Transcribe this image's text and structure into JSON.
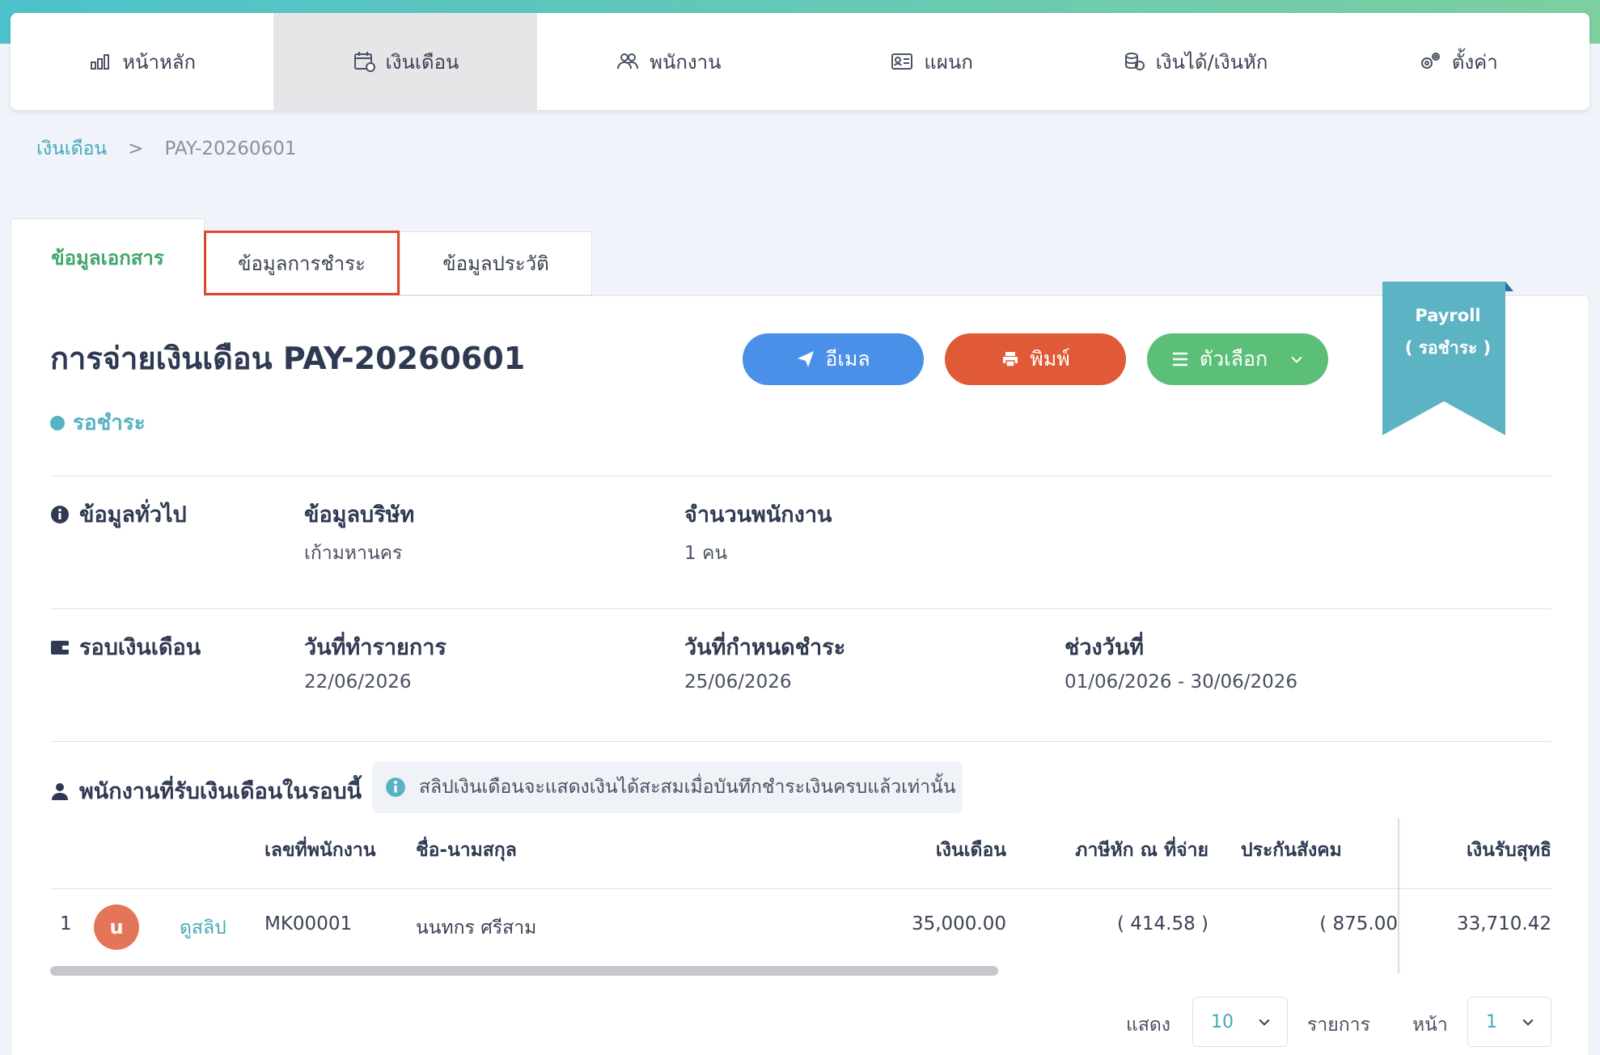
{
  "nav": {
    "items": [
      {
        "label": "หน้าหลัก",
        "icon": "chart-icon"
      },
      {
        "label": "เงินเดือน",
        "icon": "calendar-money-icon"
      },
      {
        "label": "พนักงาน",
        "icon": "users-icon"
      },
      {
        "label": "แผนก",
        "icon": "id-card-icon"
      },
      {
        "label": "เงินได้/เงินหัก",
        "icon": "coins-icon"
      },
      {
        "label": "ตั้งค่า",
        "icon": "gears-icon"
      }
    ]
  },
  "breadcrumb": {
    "parent": "เงินเดือน",
    "separator": ">",
    "current": "PAY-20260601"
  },
  "tabs": [
    {
      "label": "ข้อมูลเอกสาร"
    },
    {
      "label": "ข้อมูลการชำระ"
    },
    {
      "label": "ข้อมูลประวัติ"
    }
  ],
  "document": {
    "title": "การจ่ายเงินเดือน PAY-20260601",
    "status": "รอชำระ",
    "ribbon_line1": "Payroll",
    "ribbon_line2": "( รอชำระ )"
  },
  "actions": {
    "email": "อีเมล",
    "print": "พิมพ์",
    "options": "ตัวเลือก"
  },
  "general": {
    "section": "ข้อมูลทั่วไป",
    "company_title": "ข้อมูลบริษัท",
    "company_value": "เก้ามหานคร",
    "employees_title": "จำนวนพนักงาน",
    "employees_value": "1 คน"
  },
  "cycle": {
    "section": "รอบเงินเดือน",
    "txn_date_title": "วันที่ทำรายการ",
    "txn_date_value": "22/06/2026",
    "due_date_title": "วันที่กำหนดชำระ",
    "due_date_value": "25/06/2026",
    "range_title": "ช่วงวันที่",
    "range_value": "01/06/2026 - 30/06/2026"
  },
  "employees": {
    "section": "พนักงานที่รับเงินเดือนในรอบนี้",
    "note": "สลิปเงินเดือนจะแสดงเงินได้สะสมเมื่อบันทึกชำระเงินครบแล้วเท่านั้น",
    "columns": {
      "emp_id": "เลขที่พนักงาน",
      "name": "ชื่อ-นามสกุล",
      "salary": "เงินเดือน",
      "tax": "ภาษีหัก ณ ที่จ่าย",
      "social": "ประกันสังคม",
      "net": "เงินรับสุทธิ"
    },
    "rows": [
      {
        "no": "1",
        "avatar": "u",
        "slip": "ดูสลิป",
        "emp_id": "MK00001",
        "name": "นนทกร ศรีสาม",
        "salary": "35,000.00",
        "tax": "( 414.58 )",
        "social": "( 875.00",
        "net": "33,710.42"
      }
    ]
  },
  "pager": {
    "show_label": "แสดง",
    "page_size": "10",
    "items_label": "รายการ",
    "page_label": "หน้า",
    "page": "1"
  },
  "colors": {
    "accent_teal": "#43a9b9",
    "email_button": "#4a90e8",
    "print_button": "#e05a38",
    "options_button": "#5cbf78",
    "ribbon": "#5bb3c4"
  }
}
